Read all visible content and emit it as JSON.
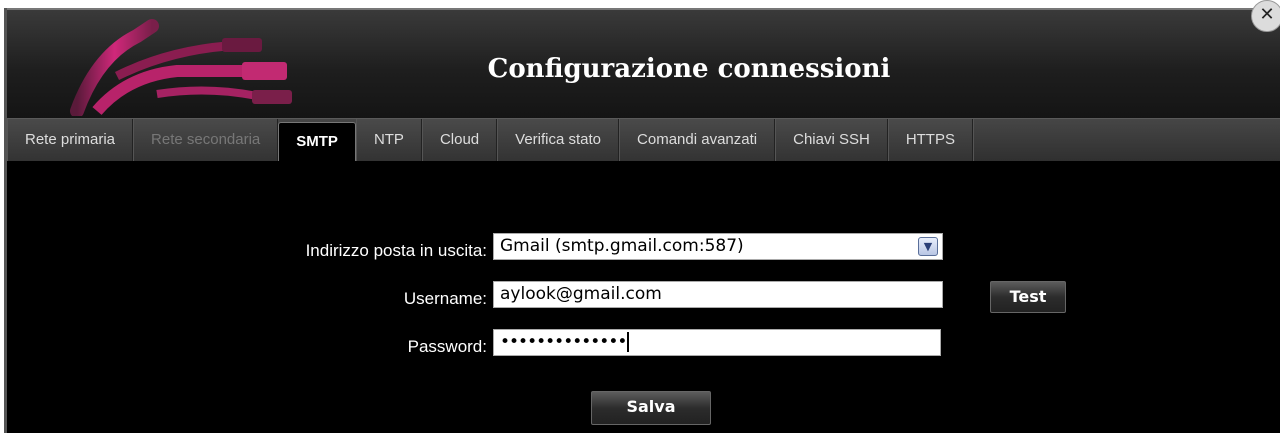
{
  "window": {
    "title": "Configurazione connessioni",
    "close_icon": "close-icon"
  },
  "tabs": [
    {
      "label": "Rete primaria",
      "state": "normal"
    },
    {
      "label": "Rete secondaria",
      "state": "disabled"
    },
    {
      "label": "SMTP",
      "state": "active"
    },
    {
      "label": "NTP",
      "state": "normal"
    },
    {
      "label": "Cloud",
      "state": "normal"
    },
    {
      "label": "Verifica stato",
      "state": "normal"
    },
    {
      "label": "Comandi avanzati",
      "state": "normal"
    },
    {
      "label": "Chiavi SSH",
      "state": "normal"
    },
    {
      "label": "HTTPS",
      "state": "normal"
    }
  ],
  "form": {
    "server_label": "Indirizzo posta in uscita:",
    "server_value": "Gmail (smtp.gmail.com:587)",
    "username_label": "Username:",
    "username_value": "aylook@gmail.com",
    "password_label": "Password:",
    "password_value": "••••••••••••••",
    "test_button": "Test",
    "save_button": "Salva"
  },
  "colors": {
    "logo_accent": "#d0287a",
    "background": "#000000"
  }
}
